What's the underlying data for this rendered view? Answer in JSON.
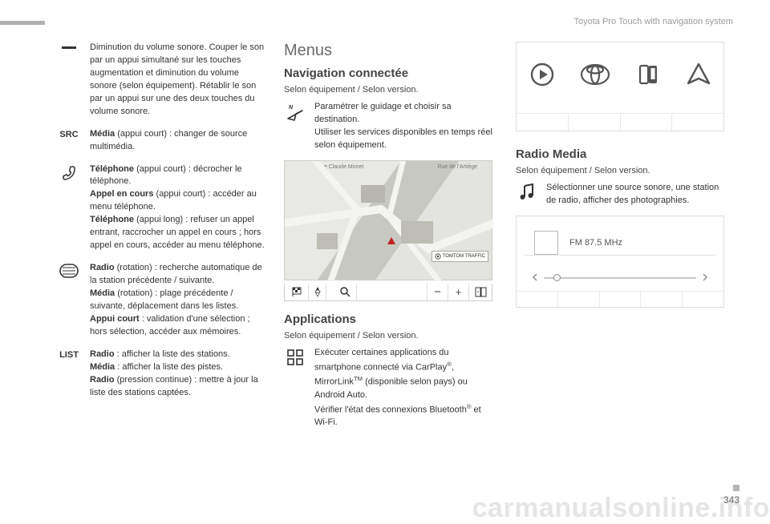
{
  "header": {
    "title": "Toyota Pro Touch with navigation system"
  },
  "page_number": "343",
  "watermark": "carmanualsonline.info",
  "left": {
    "minus_text": "Diminution du volume sonore. Couper le son par un appui simultané sur les touches augmentation et diminution du volume sonore (selon équipement). Rétablir le son par un appui sur une des deux touches du volume sonore.",
    "src_label": "SRC",
    "src_bold": "Média",
    "src_rest": " (appui court) : changer de source multimédia.",
    "phone_b1": "Téléphone",
    "phone_r1": " (appui court) : décrocher le téléphone.",
    "phone_b2": "Appel en cours",
    "phone_r2": " (appui court) : accéder au menu téléphone.",
    "phone_b3": "Téléphone",
    "phone_r3": " (appui long) : refuser un appel entrant, raccrocher un appel en cours ; hors appel en cours, accéder au menu téléphone.",
    "dial_b1": "Radio",
    "dial_r1": " (rotation) : recherche automatique de la station précédente / suivante.",
    "dial_b2": "Média",
    "dial_r2": " (rotation) : plage précédente / suivante, déplacement dans les listes.",
    "dial_b3": "Appui court",
    "dial_r3": " : validation d'une sélection ; hors sélection, accéder aux mémoires.",
    "list_label": "LIST",
    "list_b1": "Radio",
    "list_r1": " : afficher la liste des stations.",
    "list_b2": "Média",
    "list_r2": " : afficher la liste des pistes.",
    "list_b3": "Radio",
    "list_r3": " (pression continue) : mettre à jour la liste des stations captées."
  },
  "mid": {
    "menus": "Menus",
    "nav_title": "Navigation connectée",
    "nav_sub": "Selon équipement / Selon version.",
    "nav_text": "Paramétrer le guidage et choisir sa destination.\nUtiliser les services disponibles en temps réel selon équipement.",
    "map_top_left": "Rue Claude Monet",
    "map_top_right": "Rue de l'Artiège",
    "tomtom": "TOMTOM TRAFFIC",
    "mapbar": {
      "n": "N",
      "minus": "−",
      "plus": "+"
    },
    "apps_title": "Applications",
    "apps_sub": "Selon équipement / Selon version.",
    "apps_line1": "Exécuter certaines applications du smartphone connecté via CarPlay",
    "apps_reg": "®",
    "apps_line1b": ", MirrorLink",
    "apps_tm": "TM",
    "apps_line1c": " (disponible selon pays) ou Android Auto.",
    "apps_line2a": "Vérifier l'état des connexions Bluetooth",
    "apps_line2b": " et Wi-Fi."
  },
  "right": {
    "radio_title": "Radio Media",
    "radio_sub": "Selon équipement / Selon version.",
    "radio_text": "Sélectionner une source sonore, une station de radio, afficher des photographies.",
    "freq": "FM  87.5 MHz"
  }
}
